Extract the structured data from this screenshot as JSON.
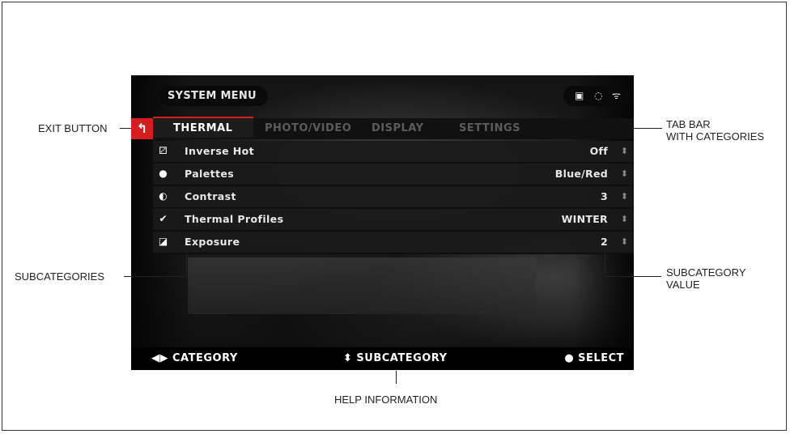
{
  "menu": {
    "title": "SYSTEM MENU",
    "exit_icon": "↰"
  },
  "status_icons": [
    {
      "name": "sd-card-icon",
      "glyph": "▣"
    },
    {
      "name": "gps-icon",
      "glyph": "◌"
    },
    {
      "name": "wifi-icon",
      "glyph": "ᯤ"
    }
  ],
  "tabs": [
    {
      "label": "THERMAL"
    },
    {
      "label": "PHOTO/VIDEO"
    },
    {
      "label": "DISPLAY"
    },
    {
      "label": "SETTINGS"
    }
  ],
  "rows": [
    {
      "label": "Inverse Hot",
      "value": "Off",
      "icon": "inverse-icon",
      "glyph": "⚂"
    },
    {
      "label": "Palettes",
      "value": "Blue/Red",
      "icon": "palette-icon",
      "glyph": "●"
    },
    {
      "label": "Contrast",
      "value": "3",
      "icon": "contrast-icon",
      "glyph": "◐"
    },
    {
      "label": "Thermal Profiles",
      "value": "WINTER",
      "icon": "check-circle-icon",
      "glyph": "✔"
    },
    {
      "label": "Exposure",
      "value": "2",
      "icon": "exposure-icon",
      "glyph": "◪"
    }
  ],
  "updown_glyph": "⬍",
  "help": {
    "category": "◀▶ CATEGORY",
    "subcategory": "⬍ SUBCATEGORY",
    "select": "● SELECT"
  },
  "callouts": {
    "exit_button": "EXIT BUTTON",
    "tab_bar_1": "TAB BAR",
    "tab_bar_2": "WITH CATEGORIES",
    "subcategories": "SUBCATEGORIES",
    "subcategory_value_1": "SUBCATEGORY",
    "subcategory_value_2": "VALUE",
    "help_information": "HELP INFORMATION"
  },
  "colors": {
    "accent": "#d21e1e",
    "background": "#0b0b0b",
    "text": "#e8e8e8",
    "inactive_tab": "#5c5c5c"
  }
}
